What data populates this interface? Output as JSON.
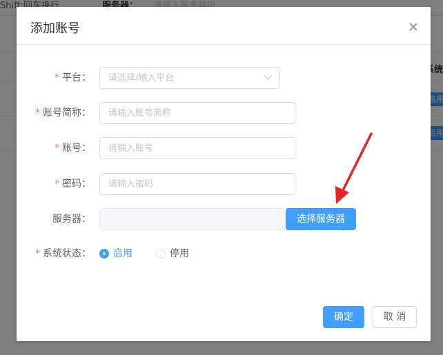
{
  "background": {
    "top_left_text": "Shift:回车换行",
    "server_filter_label": "服务器：",
    "server_filter_placeholder": "请输入服务器IP",
    "column_header": "系统",
    "badge_text": "启用"
  },
  "dialog": {
    "title": "添加账号",
    "close_icon": "close-icon"
  },
  "form": {
    "platform": {
      "label": "平台：",
      "required": true,
      "placeholder": "请选择/输入平台"
    },
    "account_alias": {
      "label": "账号简称：",
      "required": true,
      "placeholder": "请输入账号简称"
    },
    "account": {
      "label": "账号：",
      "required": true,
      "placeholder": "请输入账号"
    },
    "password": {
      "label": "密码：",
      "required": true,
      "placeholder": "请输入密码"
    },
    "server": {
      "label": "服务器：",
      "required": false,
      "value": "",
      "select_button": "选择服务器"
    },
    "status": {
      "label": "系统状态：",
      "required": true,
      "options": [
        {
          "label": "启用",
          "checked": true
        },
        {
          "label": "停用",
          "checked": false
        }
      ]
    }
  },
  "footer": {
    "confirm": "确定",
    "cancel": "取 消"
  },
  "colors": {
    "primary": "#409eff",
    "required": "#f56c6c",
    "annotation_arrow": "#e52424"
  }
}
